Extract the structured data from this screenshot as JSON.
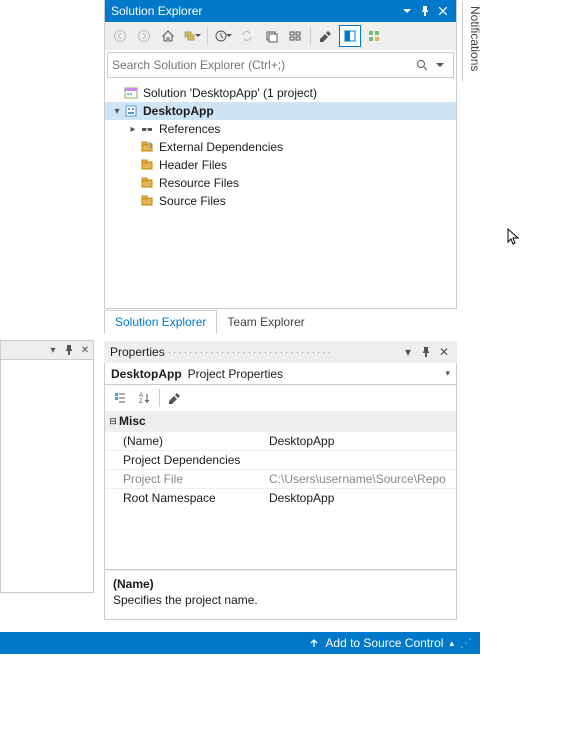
{
  "solution_explorer": {
    "title": "Solution Explorer",
    "search_placeholder": "Search Solution Explorer (Ctrl+;)",
    "solution_label": "Solution 'DesktopApp' (1 project)",
    "project_label": "DesktopApp",
    "nodes": {
      "references": "References",
      "external_deps": "External Dependencies",
      "header_files": "Header Files",
      "resource_files": "Resource Files",
      "source_files": "Source Files"
    }
  },
  "tabs": {
    "solution_explorer": "Solution Explorer",
    "team_explorer": "Team Explorer"
  },
  "properties": {
    "title": "Properties",
    "combo_name": "DesktopApp",
    "combo_type": "Project Properties",
    "category": "Misc",
    "rows": {
      "name_label": "(Name)",
      "name_value": "DesktopApp",
      "deps_label": "Project Dependencies",
      "deps_value": "",
      "file_label": "Project File",
      "file_value": "C:\\Users\\username\\Source\\Repo",
      "ns_label": "Root Namespace",
      "ns_value": "DesktopApp"
    },
    "desc_name": "(Name)",
    "desc_text": "Specifies the project name."
  },
  "notifications": "Notifications",
  "statusbar": {
    "add_source": "Add to Source Control"
  }
}
